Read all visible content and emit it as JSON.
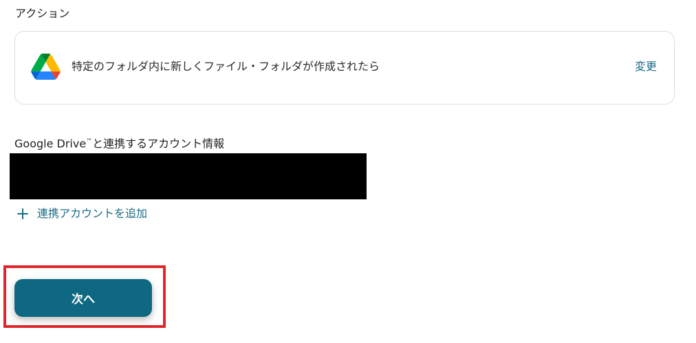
{
  "section": {
    "title": "アクション"
  },
  "action_card": {
    "icon": "google-drive-icon",
    "description": "特定のフォルダ内に新しくファイル・フォルダが作成されたら",
    "change_label": "変更"
  },
  "account": {
    "label_prefix": "Google Drive",
    "label_tm": "™",
    "label_suffix": "と連携するアカウント情報",
    "add_icon": "plus-icon",
    "add_label": "連携アカウントを追加"
  },
  "footer": {
    "next_label": "次へ"
  },
  "colors": {
    "accent": "#0f6882",
    "link": "#1a6b85",
    "highlight": "#e0262b",
    "card_border": "#d9dde2"
  }
}
